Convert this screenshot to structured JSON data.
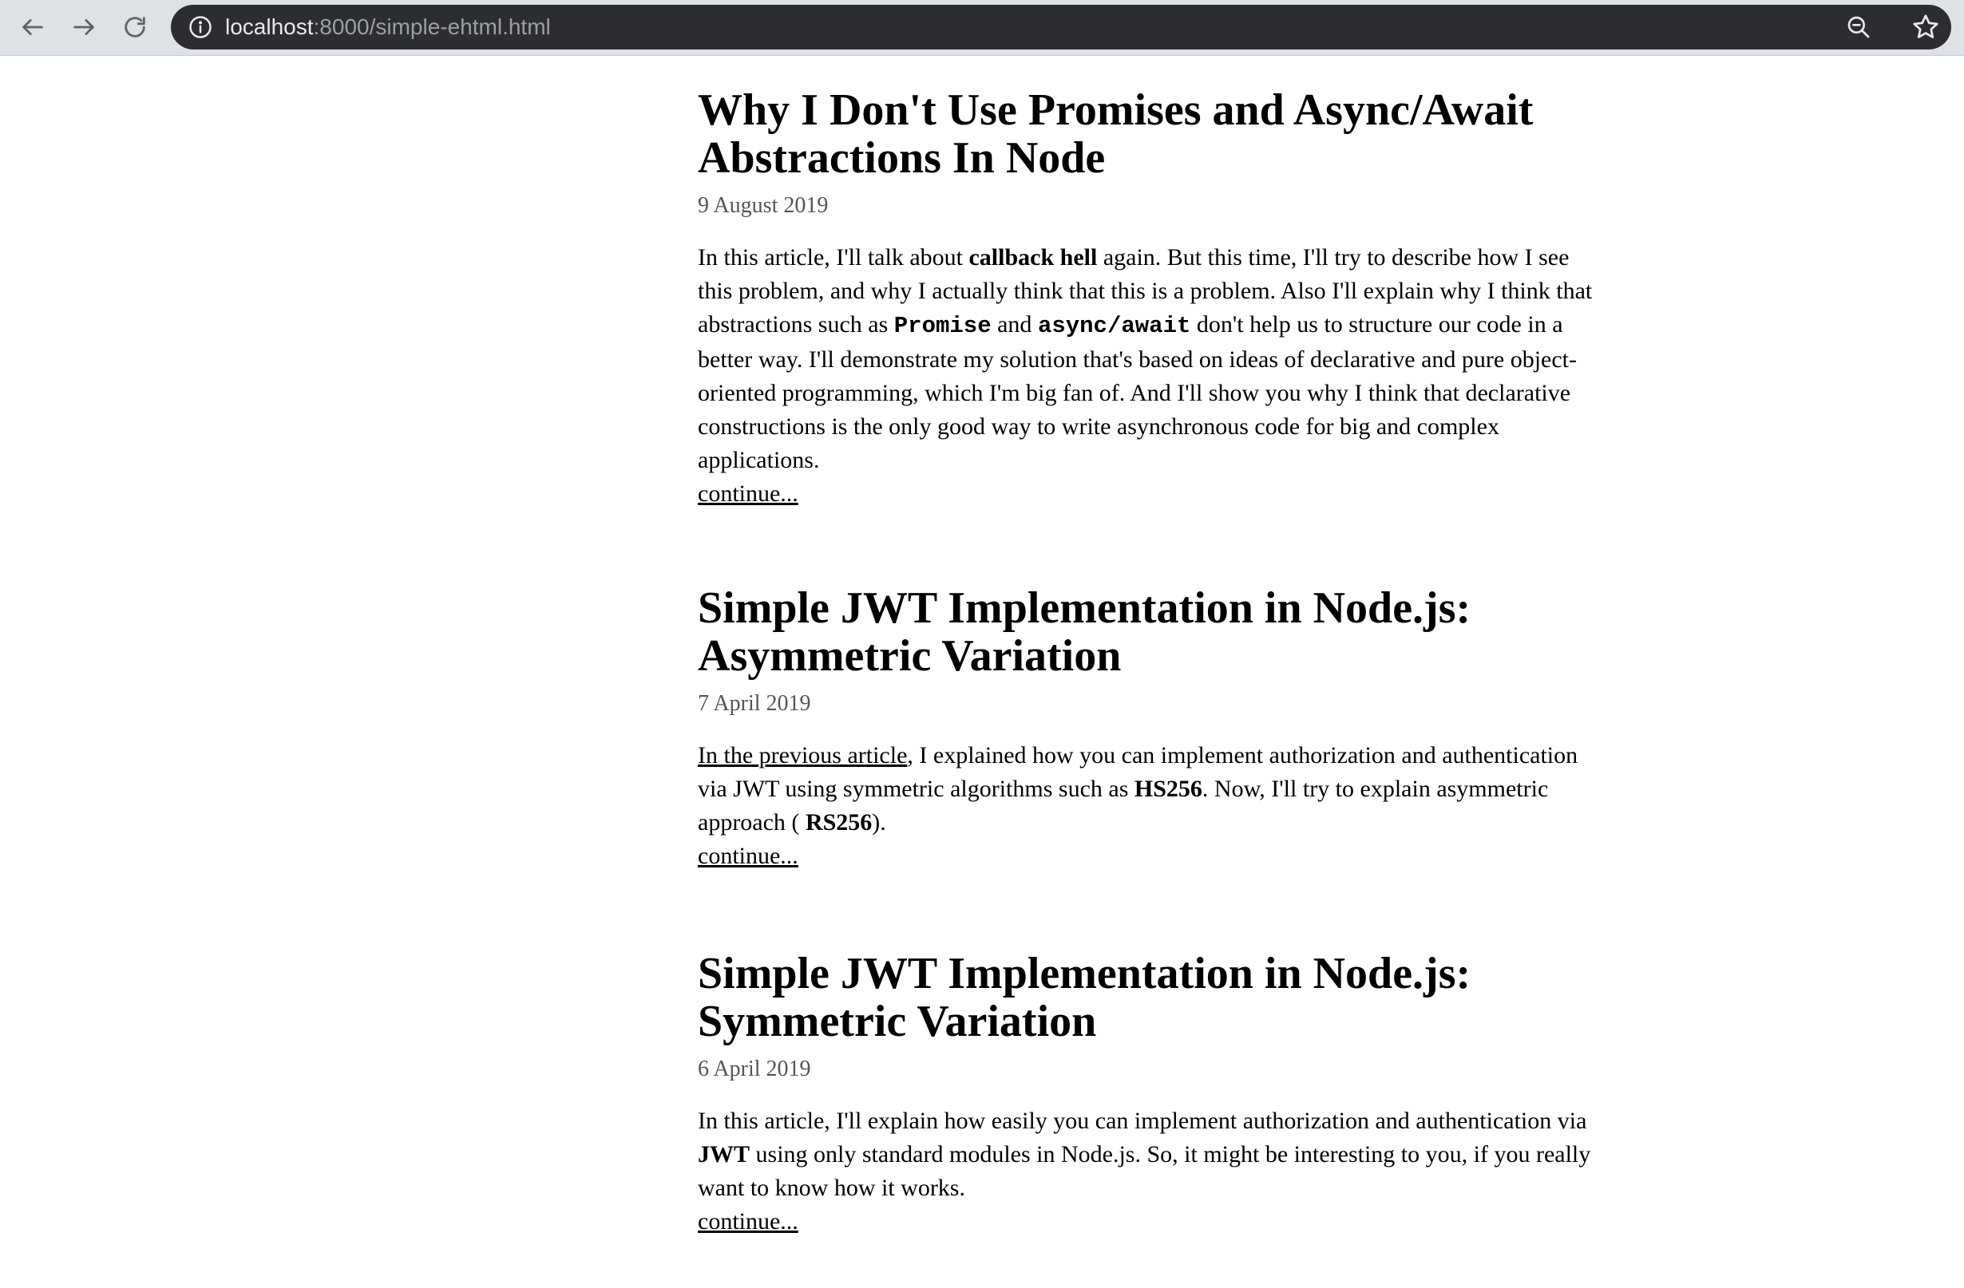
{
  "browser": {
    "url_host": "localhost",
    "url_path": ":8000/simple-ehtml.html"
  },
  "articles": [
    {
      "title": "Why I Don't Use Promises and Async/Await Abstractions In Node",
      "date": "9 August 2019",
      "body": [
        {
          "t": "In this article, I'll talk about "
        },
        {
          "t": "callback hell",
          "s": "b"
        },
        {
          "t": " again. But this time, I'll try to describe how I see this problem, and why I actually think that this is a problem. Also I'll explain why I think that abstractions such as "
        },
        {
          "t": "Promise",
          "s": "code"
        },
        {
          "t": " and "
        },
        {
          "t": "async/await",
          "s": "code"
        },
        {
          "t": " don't help us to structure our code in a better way. I'll demonstrate my solution that's based on ideas of declarative and pure object-oriented programming, which I'm big fan of. And I'll show you why I think that declarative constructions is the only good way to write asynchronous code for big and complex applications."
        }
      ],
      "continue_label": "continue..."
    },
    {
      "title": "Simple JWT Implementation in Node.js: Asymmetric Variation",
      "date": "7 April 2019",
      "body": [
        {
          "t": "In the previous article",
          "s": "link"
        },
        {
          "t": ", I explained how you can implement authorization and authentication via JWT using symmetric algorithms such as "
        },
        {
          "t": "HS256",
          "s": "b"
        },
        {
          "t": ". Now, I'll try to explain asymmetric approach ( "
        },
        {
          "t": "RS256",
          "s": "b"
        },
        {
          "t": ")."
        }
      ],
      "continue_label": "continue..."
    },
    {
      "title": "Simple JWT Implementation in Node.js: Symmetric Variation",
      "date": "6 April 2019",
      "body": [
        {
          "t": "In this article, I'll explain how easily you can implement authorization and authentication via "
        },
        {
          "t": "JWT",
          "s": "b"
        },
        {
          "t": " using only standard modules in Node.js. So, it might be interesting to you, if you really want to know how it works."
        }
      ],
      "continue_label": "continue..."
    }
  ]
}
